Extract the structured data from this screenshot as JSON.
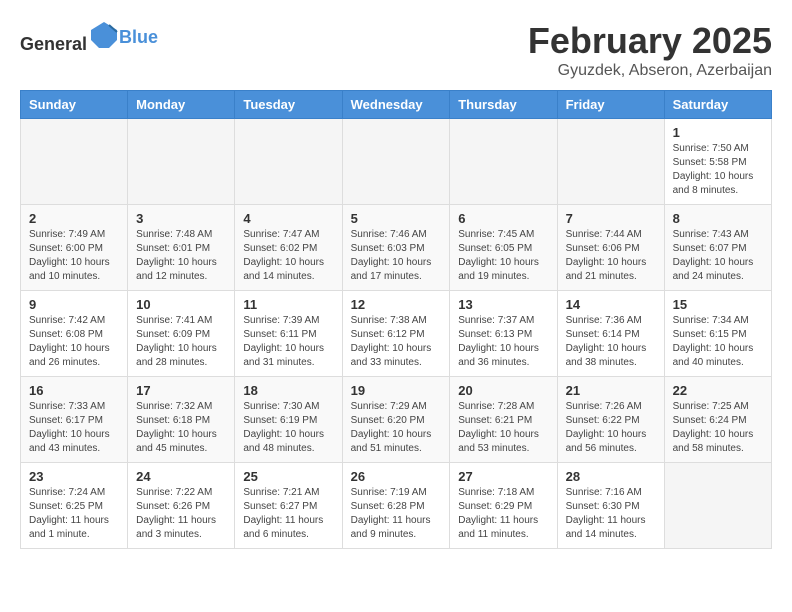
{
  "header": {
    "logo_general": "General",
    "logo_blue": "Blue",
    "month": "February 2025",
    "location": "Gyuzdek, Abseron, Azerbaijan"
  },
  "weekdays": [
    "Sunday",
    "Monday",
    "Tuesday",
    "Wednesday",
    "Thursday",
    "Friday",
    "Saturday"
  ],
  "weeks": [
    [
      {
        "day": "",
        "info": ""
      },
      {
        "day": "",
        "info": ""
      },
      {
        "day": "",
        "info": ""
      },
      {
        "day": "",
        "info": ""
      },
      {
        "day": "",
        "info": ""
      },
      {
        "day": "",
        "info": ""
      },
      {
        "day": "1",
        "info": "Sunrise: 7:50 AM\nSunset: 5:58 PM\nDaylight: 10 hours and 8 minutes."
      }
    ],
    [
      {
        "day": "2",
        "info": "Sunrise: 7:49 AM\nSunset: 6:00 PM\nDaylight: 10 hours and 10 minutes."
      },
      {
        "day": "3",
        "info": "Sunrise: 7:48 AM\nSunset: 6:01 PM\nDaylight: 10 hours and 12 minutes."
      },
      {
        "day": "4",
        "info": "Sunrise: 7:47 AM\nSunset: 6:02 PM\nDaylight: 10 hours and 14 minutes."
      },
      {
        "day": "5",
        "info": "Sunrise: 7:46 AM\nSunset: 6:03 PM\nDaylight: 10 hours and 17 minutes."
      },
      {
        "day": "6",
        "info": "Sunrise: 7:45 AM\nSunset: 6:05 PM\nDaylight: 10 hours and 19 minutes."
      },
      {
        "day": "7",
        "info": "Sunrise: 7:44 AM\nSunset: 6:06 PM\nDaylight: 10 hours and 21 minutes."
      },
      {
        "day": "8",
        "info": "Sunrise: 7:43 AM\nSunset: 6:07 PM\nDaylight: 10 hours and 24 minutes."
      }
    ],
    [
      {
        "day": "9",
        "info": "Sunrise: 7:42 AM\nSunset: 6:08 PM\nDaylight: 10 hours and 26 minutes."
      },
      {
        "day": "10",
        "info": "Sunrise: 7:41 AM\nSunset: 6:09 PM\nDaylight: 10 hours and 28 minutes."
      },
      {
        "day": "11",
        "info": "Sunrise: 7:39 AM\nSunset: 6:11 PM\nDaylight: 10 hours and 31 minutes."
      },
      {
        "day": "12",
        "info": "Sunrise: 7:38 AM\nSunset: 6:12 PM\nDaylight: 10 hours and 33 minutes."
      },
      {
        "day": "13",
        "info": "Sunrise: 7:37 AM\nSunset: 6:13 PM\nDaylight: 10 hours and 36 minutes."
      },
      {
        "day": "14",
        "info": "Sunrise: 7:36 AM\nSunset: 6:14 PM\nDaylight: 10 hours and 38 minutes."
      },
      {
        "day": "15",
        "info": "Sunrise: 7:34 AM\nSunset: 6:15 PM\nDaylight: 10 hours and 40 minutes."
      }
    ],
    [
      {
        "day": "16",
        "info": "Sunrise: 7:33 AM\nSunset: 6:17 PM\nDaylight: 10 hours and 43 minutes."
      },
      {
        "day": "17",
        "info": "Sunrise: 7:32 AM\nSunset: 6:18 PM\nDaylight: 10 hours and 45 minutes."
      },
      {
        "day": "18",
        "info": "Sunrise: 7:30 AM\nSunset: 6:19 PM\nDaylight: 10 hours and 48 minutes."
      },
      {
        "day": "19",
        "info": "Sunrise: 7:29 AM\nSunset: 6:20 PM\nDaylight: 10 hours and 51 minutes."
      },
      {
        "day": "20",
        "info": "Sunrise: 7:28 AM\nSunset: 6:21 PM\nDaylight: 10 hours and 53 minutes."
      },
      {
        "day": "21",
        "info": "Sunrise: 7:26 AM\nSunset: 6:22 PM\nDaylight: 10 hours and 56 minutes."
      },
      {
        "day": "22",
        "info": "Sunrise: 7:25 AM\nSunset: 6:24 PM\nDaylight: 10 hours and 58 minutes."
      }
    ],
    [
      {
        "day": "23",
        "info": "Sunrise: 7:24 AM\nSunset: 6:25 PM\nDaylight: 11 hours and 1 minute."
      },
      {
        "day": "24",
        "info": "Sunrise: 7:22 AM\nSunset: 6:26 PM\nDaylight: 11 hours and 3 minutes."
      },
      {
        "day": "25",
        "info": "Sunrise: 7:21 AM\nSunset: 6:27 PM\nDaylight: 11 hours and 6 minutes."
      },
      {
        "day": "26",
        "info": "Sunrise: 7:19 AM\nSunset: 6:28 PM\nDaylight: 11 hours and 9 minutes."
      },
      {
        "day": "27",
        "info": "Sunrise: 7:18 AM\nSunset: 6:29 PM\nDaylight: 11 hours and 11 minutes."
      },
      {
        "day": "28",
        "info": "Sunrise: 7:16 AM\nSunset: 6:30 PM\nDaylight: 11 hours and 14 minutes."
      },
      {
        "day": "",
        "info": ""
      }
    ]
  ]
}
